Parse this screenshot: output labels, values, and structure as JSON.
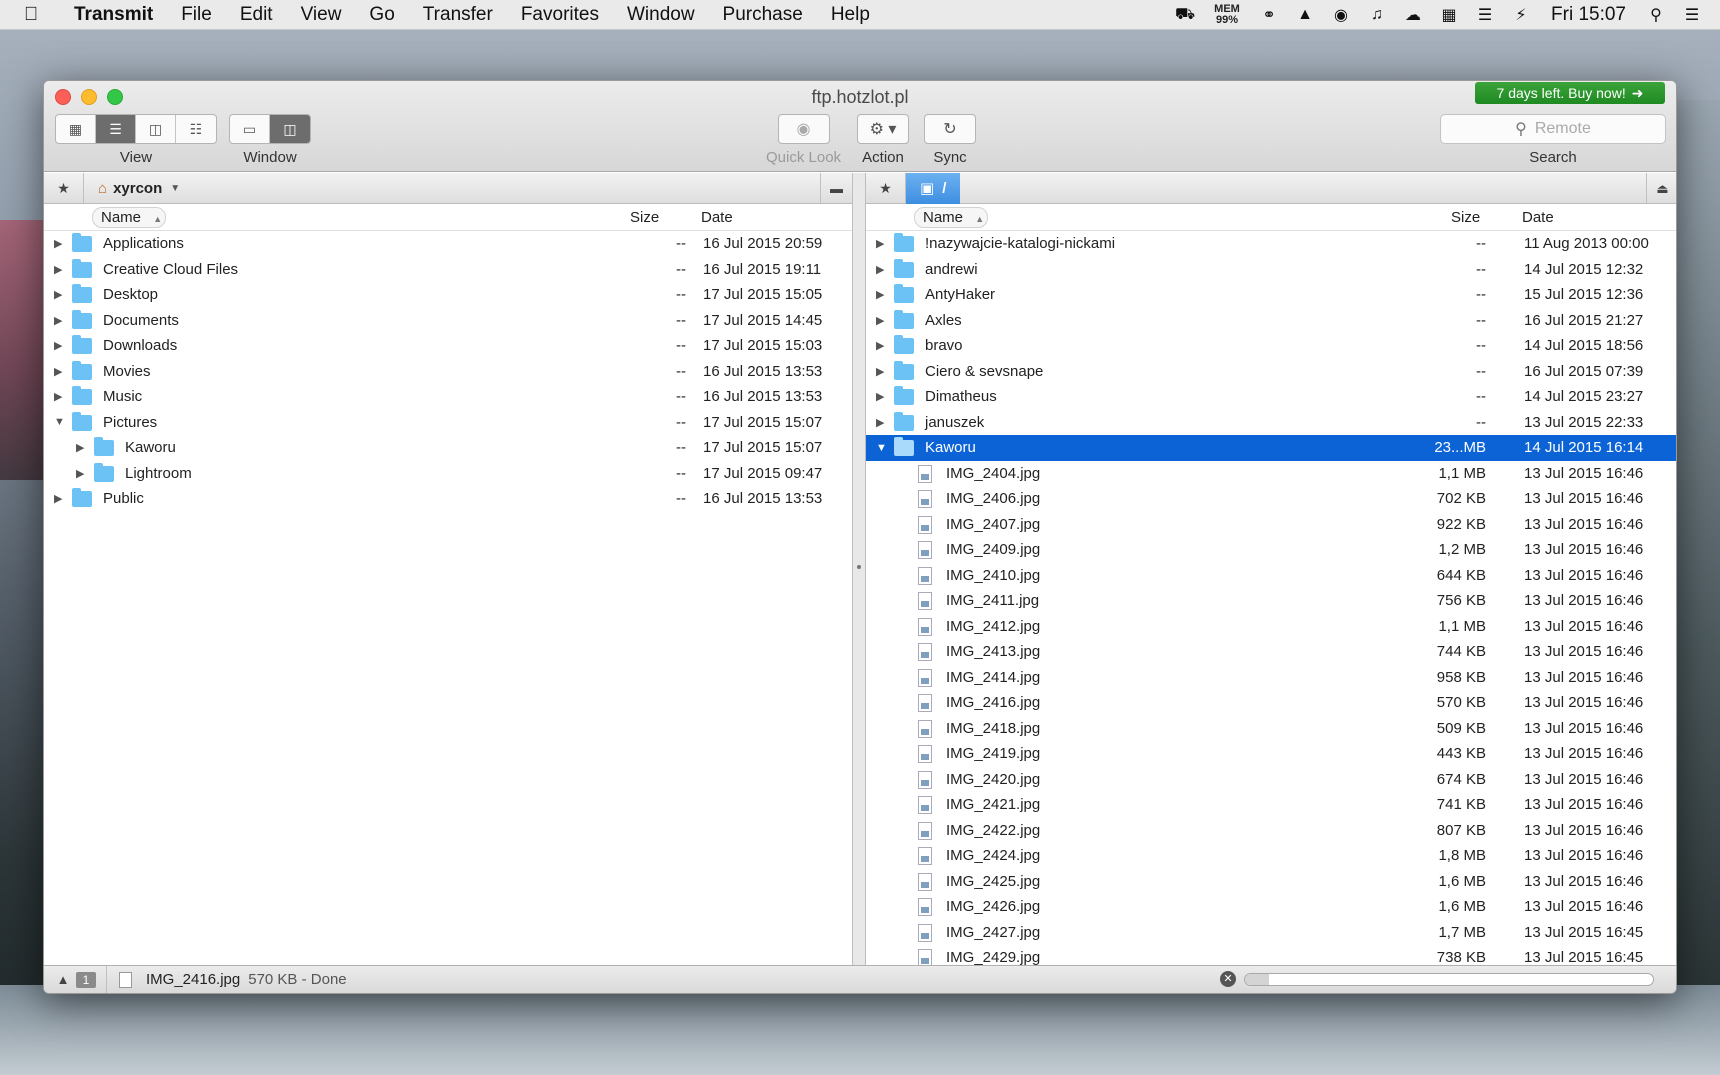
{
  "menubar": {
    "app_name": "Transmit",
    "items": [
      "File",
      "Edit",
      "View",
      "Go",
      "Transfer",
      "Favorites",
      "Window",
      "Purchase",
      "Help"
    ],
    "mem_label": "MEM",
    "mem_value": "99%",
    "clock": "Fri 15:07"
  },
  "window": {
    "title": "ftp.hotzlot.pl",
    "buy_badge": "7 days left. Buy now!",
    "toolbar": {
      "view_label": "View",
      "window_label": "Window",
      "quick_look_label": "Quick Look",
      "action_label": "Action",
      "sync_label": "Sync",
      "search_placeholder": "Remote",
      "search_label": "Search"
    }
  },
  "left_pane": {
    "path": "xyrcon",
    "columns": {
      "name": "Name",
      "size": "Size",
      "date": "Date"
    },
    "rows": [
      {
        "name": "Applications",
        "size": "--",
        "date": "16 Jul 2015 20:59",
        "level": 0,
        "expanded": false
      },
      {
        "name": "Creative Cloud Files",
        "size": "--",
        "date": "16 Jul 2015 19:11",
        "level": 0,
        "expanded": false
      },
      {
        "name": "Desktop",
        "size": "--",
        "date": "17 Jul 2015 15:05",
        "level": 0,
        "expanded": false
      },
      {
        "name": "Documents",
        "size": "--",
        "date": "17 Jul 2015 14:45",
        "level": 0,
        "expanded": false
      },
      {
        "name": "Downloads",
        "size": "--",
        "date": "17 Jul 2015 15:03",
        "level": 0,
        "expanded": false
      },
      {
        "name": "Movies",
        "size": "--",
        "date": "16 Jul 2015 13:53",
        "level": 0,
        "expanded": false
      },
      {
        "name": "Music",
        "size": "--",
        "date": "16 Jul 2015 13:53",
        "level": 0,
        "expanded": false
      },
      {
        "name": "Pictures",
        "size": "--",
        "date": "17 Jul 2015 15:07",
        "level": 0,
        "expanded": true
      },
      {
        "name": "Kaworu",
        "size": "--",
        "date": "17 Jul 2015 15:07",
        "level": 1,
        "expanded": false
      },
      {
        "name": "Lightroom",
        "size": "--",
        "date": "17 Jul 2015 09:47",
        "level": 1,
        "expanded": false
      },
      {
        "name": "Public",
        "size": "--",
        "date": "16 Jul 2015 13:53",
        "level": 0,
        "expanded": false
      }
    ]
  },
  "right_pane": {
    "path": "/",
    "columns": {
      "name": "Name",
      "size": "Size",
      "date": "Date"
    },
    "rows": [
      {
        "name": "!nazywajcie-katalogi-nickami",
        "size": "--",
        "date": "11 Aug 2013 00:00",
        "type": "folder"
      },
      {
        "name": "andrewi",
        "size": "--",
        "date": "14 Jul 2015 12:32",
        "type": "folder"
      },
      {
        "name": "AntyHaker",
        "size": "--",
        "date": "15 Jul 2015 12:36",
        "type": "folder"
      },
      {
        "name": "Axles",
        "size": "--",
        "date": "16 Jul 2015 21:27",
        "type": "folder"
      },
      {
        "name": "bravo",
        "size": "--",
        "date": "14 Jul 2015 18:56",
        "type": "folder"
      },
      {
        "name": "Ciero & sevsnape",
        "size": "--",
        "date": "16 Jul 2015 07:39",
        "type": "folder"
      },
      {
        "name": "Dimatheus",
        "size": "--",
        "date": "14 Jul 2015 23:27",
        "type": "folder"
      },
      {
        "name": "januszek",
        "size": "--",
        "date": "13 Jul 2015 22:33",
        "type": "folder"
      },
      {
        "name": "Kaworu",
        "size": "23...MB",
        "date": "14 Jul 2015 16:14",
        "type": "folder",
        "selected": true,
        "expanded": true
      },
      {
        "name": "IMG_2404.jpg",
        "size": "1,1 MB",
        "date": "13 Jul 2015 16:46",
        "type": "file"
      },
      {
        "name": "IMG_2406.jpg",
        "size": "702 KB",
        "date": "13 Jul 2015 16:46",
        "type": "file"
      },
      {
        "name": "IMG_2407.jpg",
        "size": "922 KB",
        "date": "13 Jul 2015 16:46",
        "type": "file"
      },
      {
        "name": "IMG_2409.jpg",
        "size": "1,2 MB",
        "date": "13 Jul 2015 16:46",
        "type": "file"
      },
      {
        "name": "IMG_2410.jpg",
        "size": "644 KB",
        "date": "13 Jul 2015 16:46",
        "type": "file"
      },
      {
        "name": "IMG_2411.jpg",
        "size": "756 KB",
        "date": "13 Jul 2015 16:46",
        "type": "file"
      },
      {
        "name": "IMG_2412.jpg",
        "size": "1,1 MB",
        "date": "13 Jul 2015 16:46",
        "type": "file"
      },
      {
        "name": "IMG_2413.jpg",
        "size": "744 KB",
        "date": "13 Jul 2015 16:46",
        "type": "file"
      },
      {
        "name": "IMG_2414.jpg",
        "size": "958 KB",
        "date": "13 Jul 2015 16:46",
        "type": "file"
      },
      {
        "name": "IMG_2416.jpg",
        "size": "570 KB",
        "date": "13 Jul 2015 16:46",
        "type": "file"
      },
      {
        "name": "IMG_2418.jpg",
        "size": "509 KB",
        "date": "13 Jul 2015 16:46",
        "type": "file"
      },
      {
        "name": "IMG_2419.jpg",
        "size": "443 KB",
        "date": "13 Jul 2015 16:46",
        "type": "file"
      },
      {
        "name": "IMG_2420.jpg",
        "size": "674 KB",
        "date": "13 Jul 2015 16:46",
        "type": "file"
      },
      {
        "name": "IMG_2421.jpg",
        "size": "741 KB",
        "date": "13 Jul 2015 16:46",
        "type": "file"
      },
      {
        "name": "IMG_2422.jpg",
        "size": "807 KB",
        "date": "13 Jul 2015 16:46",
        "type": "file"
      },
      {
        "name": "IMG_2424.jpg",
        "size": "1,8 MB",
        "date": "13 Jul 2015 16:46",
        "type": "file"
      },
      {
        "name": "IMG_2425.jpg",
        "size": "1,6 MB",
        "date": "13 Jul 2015 16:46",
        "type": "file"
      },
      {
        "name": "IMG_2426.jpg",
        "size": "1,6 MB",
        "date": "13 Jul 2015 16:46",
        "type": "file"
      },
      {
        "name": "IMG_2427.jpg",
        "size": "1,7 MB",
        "date": "13 Jul 2015 16:45",
        "type": "file"
      },
      {
        "name": "IMG_2429.jpg",
        "size": "738 KB",
        "date": "13 Jul 2015 16:45",
        "type": "file"
      }
    ]
  },
  "statusbar": {
    "transfer_count": "1",
    "file_name": "IMG_2416.jpg",
    "file_status": "570 KB - Done",
    "progress": 0.06
  },
  "colors": {
    "selection": "#0b63d6",
    "folder": "#6cc2f5",
    "buy_badge": "#2a972d"
  }
}
